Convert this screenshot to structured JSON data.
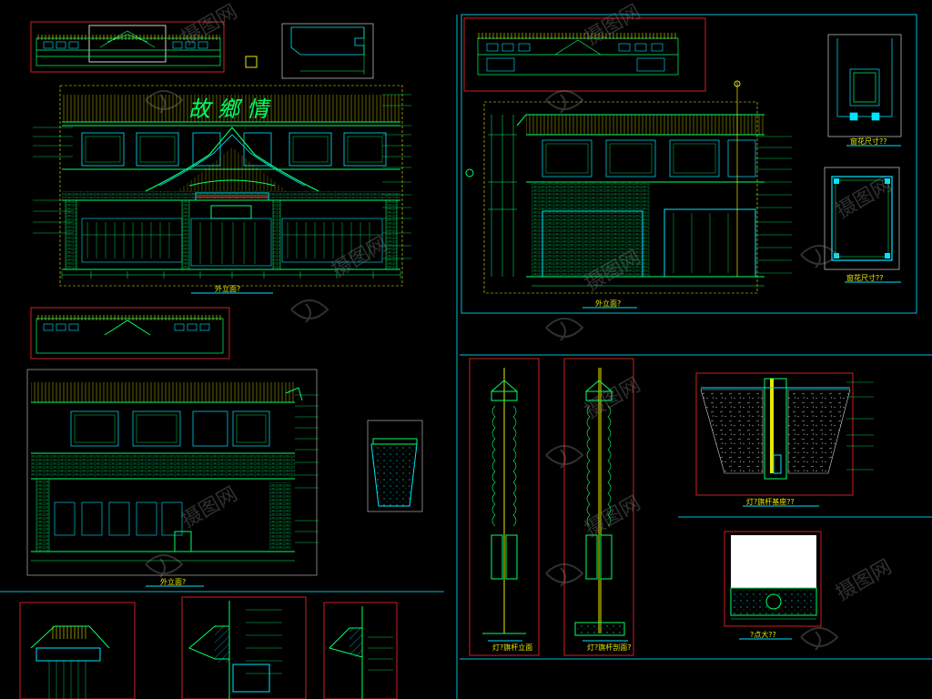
{
  "sheet": {
    "background": "#000000",
    "colors": {
      "line_green": "#00ff66",
      "line_cyan": "#00e5ff",
      "line_yellow": "#e8e800",
      "border_red": "#cc1f1f",
      "frame_cyan": "#00bcd4",
      "text_green": "#00ff66",
      "text_yellow": "#f0f000",
      "watermark": "#8a8a8a"
    }
  },
  "labels": {
    "main_facade": "外立面?",
    "right_facade": "外立面?",
    "lower_facade": "外立面?",
    "window_detail": "窗花尺寸??",
    "window_detail_2": "窗花尺寸??",
    "flagpole_elevation": "灯?旗杆立面",
    "flagpole_section": "灯?旗杆剖面?",
    "flagpole_base": "灯?旗杆基座??",
    "node_detail": "?点大??",
    "signboard": "故鄉情"
  },
  "watermark": {
    "icon": "logo-swirl-icon",
    "text": "摄图网"
  }
}
